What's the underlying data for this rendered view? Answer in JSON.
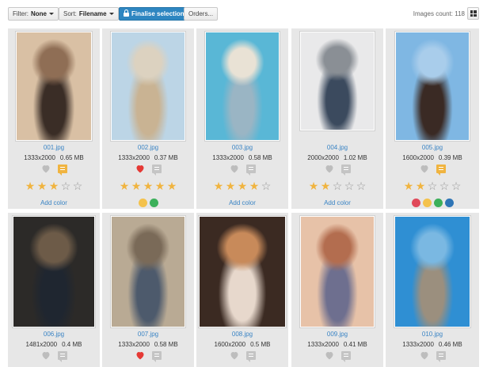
{
  "toolbar": {
    "filter_label": "Filter:",
    "filter_value": "None",
    "sort_label": "Sort:",
    "sort_value": "Filename",
    "finalise_label": "Finalise selection",
    "orders_label": "Orders...",
    "count_label": "Images count:",
    "count_value": "118"
  },
  "colors": {
    "accent": "#2e86c1",
    "link": "#3a84c4",
    "star": "#f0b440",
    "heart_active": "#e53935",
    "comment_active": "#f0b440"
  },
  "images": [
    {
      "filename": "001.jpg",
      "dimensions": "1333x2000",
      "size": "0.65 MB",
      "liked": false,
      "commented": true,
      "rating": 3,
      "add_color": "Add color",
      "colors": [],
      "photo": [
        "#d9c0a4",
        "#8f6e55",
        "#3a2d26"
      ]
    },
    {
      "filename": "002.jpg",
      "dimensions": "1333x2000",
      "size": "0.37 MB",
      "liked": true,
      "commented": false,
      "rating": 5,
      "add_color": "",
      "colors": [
        "#f4c24c",
        "#3cb05a"
      ],
      "photo": [
        "#bcd5e6",
        "#dcd2c0",
        "#c9b393"
      ]
    },
    {
      "filename": "003.jpg",
      "dimensions": "1333x2000",
      "size": "0.58 MB",
      "liked": false,
      "commented": false,
      "rating": 4,
      "add_color": "Add color",
      "colors": [],
      "photo": [
        "#59b7d6",
        "#e9e2d5",
        "#9ab5c4"
      ]
    },
    {
      "filename": "004.jpg",
      "dimensions": "2000x2000",
      "size": "1.02 MB",
      "liked": false,
      "commented": false,
      "rating": 2,
      "add_color": "Add color",
      "colors": [],
      "photo": [
        "#e9e9ea",
        "#8a8f95",
        "#3b4a5e"
      ]
    },
    {
      "filename": "005.jpg",
      "dimensions": "1600x2000",
      "size": "0.39 MB",
      "liked": false,
      "commented": true,
      "rating": 2,
      "add_color": "",
      "colors": [
        "#e0495a",
        "#f4c24c",
        "#3cb05a",
        "#2e75b6"
      ],
      "photo": [
        "#7fb7e3",
        "#a9cdeb",
        "#3a2a24"
      ]
    },
    {
      "filename": "006.jpg",
      "dimensions": "1481x2000",
      "size": "0.4 MB",
      "liked": false,
      "commented": false,
      "rating": 0,
      "add_color": "",
      "colors": [],
      "photo": [
        "#2c2a28",
        "#6d5b48",
        "#1f2630"
      ]
    },
    {
      "filename": "007.jpg",
      "dimensions": "1333x2000",
      "size": "0.58 MB",
      "liked": true,
      "commented": false,
      "rating": 0,
      "add_color": "",
      "colors": [],
      "photo": [
        "#b9aa94",
        "#7a6a58",
        "#4d5a6c"
      ]
    },
    {
      "filename": "008.jpg",
      "dimensions": "1600x2000",
      "size": "0.5 MB",
      "liked": false,
      "commented": false,
      "rating": 0,
      "add_color": "",
      "colors": [],
      "photo": [
        "#3b2a22",
        "#c88a5a",
        "#e7d8cc"
      ]
    },
    {
      "filename": "009.jpg",
      "dimensions": "1333x2000",
      "size": "0.41 MB",
      "liked": false,
      "commented": false,
      "rating": 0,
      "add_color": "",
      "colors": [],
      "photo": [
        "#e7c2a8",
        "#b36d4f",
        "#6e6f8f"
      ]
    },
    {
      "filename": "010.jpg",
      "dimensions": "1333x2000",
      "size": "0.46 MB",
      "liked": false,
      "commented": false,
      "rating": 0,
      "add_color": "",
      "colors": [],
      "photo": [
        "#2f8fd3",
        "#7ab8e2",
        "#9b8f7e"
      ]
    }
  ]
}
